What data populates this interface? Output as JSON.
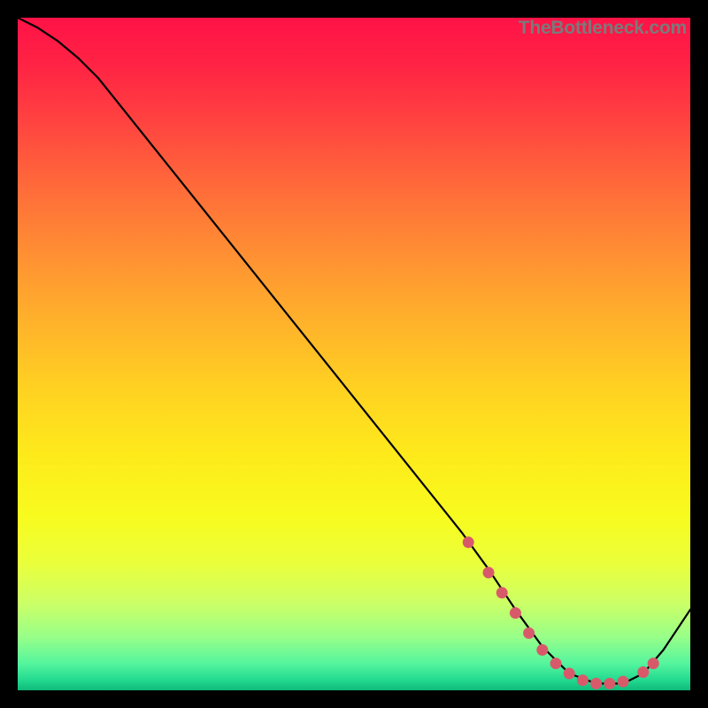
{
  "watermark": "TheBottleneck.com",
  "colors": {
    "bg": "#000000",
    "line": "#000000",
    "marker": "#d85a6a",
    "gradient": [
      {
        "stop": 0.0,
        "color": "#ff1247"
      },
      {
        "stop": 0.07,
        "color": "#ff2344"
      },
      {
        "stop": 0.15,
        "color": "#ff4140"
      },
      {
        "stop": 0.25,
        "color": "#ff6a3a"
      },
      {
        "stop": 0.35,
        "color": "#ff8f33"
      },
      {
        "stop": 0.45,
        "color": "#ffb12b"
      },
      {
        "stop": 0.55,
        "color": "#ffd122"
      },
      {
        "stop": 0.65,
        "color": "#feea1b"
      },
      {
        "stop": 0.74,
        "color": "#f8fb1e"
      },
      {
        "stop": 0.81,
        "color": "#eaff3a"
      },
      {
        "stop": 0.87,
        "color": "#ccff66"
      },
      {
        "stop": 0.92,
        "color": "#99ff88"
      },
      {
        "stop": 0.96,
        "color": "#55f59e"
      },
      {
        "stop": 0.985,
        "color": "#22d98f"
      },
      {
        "stop": 1.0,
        "color": "#0fb979"
      }
    ]
  },
  "chart_data": {
    "type": "line",
    "title": "",
    "xlabel": "",
    "ylabel": "",
    "xlim": [
      0,
      100
    ],
    "ylim": [
      0,
      100
    ],
    "series": [
      {
        "name": "curve",
        "x": [
          0,
          3,
          6,
          9,
          12,
          20,
          30,
          40,
          50,
          60,
          66,
          70,
          74,
          78,
          82,
          86,
          90,
          93,
          96,
          100
        ],
        "y": [
          100,
          98.5,
          96.5,
          94,
          91,
          81,
          68.5,
          56,
          43.5,
          31,
          23.5,
          18,
          12,
          6.5,
          2.5,
          1,
          1,
          2.5,
          6,
          12
        ]
      }
    ],
    "markers": {
      "name": "highlight",
      "x": [
        67,
        70,
        72,
        74,
        76,
        78,
        80,
        82,
        84,
        86,
        88,
        90,
        93,
        94.5
      ],
      "y": [
        22,
        17.5,
        14.5,
        11.5,
        8.5,
        6,
        4,
        2.5,
        1.5,
        1,
        1,
        1.3,
        2.7,
        4
      ]
    }
  }
}
